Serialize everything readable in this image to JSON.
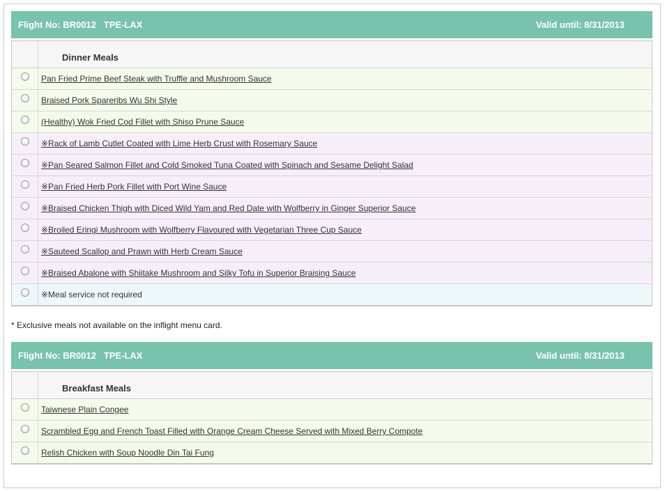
{
  "dinner": {
    "header": {
      "flight_label": "Flight No: BR0012   TPE-LAX",
      "valid_label": "Valid until: 8/31/2013"
    },
    "section_title": "Dinner Meals",
    "meals": [
      {
        "label": "Pan Fried Prime Beef Steak with Truffle and Mushroom Sauce"
      },
      {
        "label": "Braised Pork Spareribs Wu Shi Style"
      },
      {
        "label": "(Healthy) Wok Fried Cod Fillet with Shiso Prune Sauce"
      },
      {
        "label": "※Rack of Lamb Cutlet Coated with Lime Herb Crust with Rosemary Sauce"
      },
      {
        "label": "※Pan Seared Salmon Fillet and Cold Smoked Tuna Coated with Spinach and Sesame Delight Salad"
      },
      {
        "label": "※Pan Fried Herb Pork Fillet with Port Wine Sauce"
      },
      {
        "label": "※Braised Chicken Thigh with Diced Wild Yam and Red Date with Wolfberry in Ginger Superior Sauce"
      },
      {
        "label": "※Broiled Eringi Mushroom with Wolfberry Flavoured with Vegetarian Three Cup Sauce"
      },
      {
        "label": "※Sauteed Scallop and Prawn with Herb Cream Sauce"
      },
      {
        "label": "※Braised Abalone with Shiitake Mushroom and Silky Tofu in Superior Braising Sauce"
      },
      {
        "label": "※Meal service not required"
      }
    ]
  },
  "note": "* Exclusive meals not available on the inflight menu card.",
  "breakfast": {
    "header": {
      "flight_label": "Flight No: BR0012   TPE-LAX",
      "valid_label": "Valid until: 8/31/2013"
    },
    "section_title": "Breakfast Meals",
    "meals": [
      {
        "label": "Taiwnese Plain Congee"
      },
      {
        "label": "Scrambled Egg and French Toast Filled with Orange Cream Cheese Served with Mixed Berry Compote"
      },
      {
        "label": "Relish Chicken with Soup Noodle Din Tai Fung"
      }
    ]
  },
  "colors": {
    "header_bg": "#79c3ac",
    "regular_row_bg": "#f5fbec",
    "exclusive_row_bg": "#f6eff9",
    "no_meal_row_bg": "#eef8fa"
  }
}
